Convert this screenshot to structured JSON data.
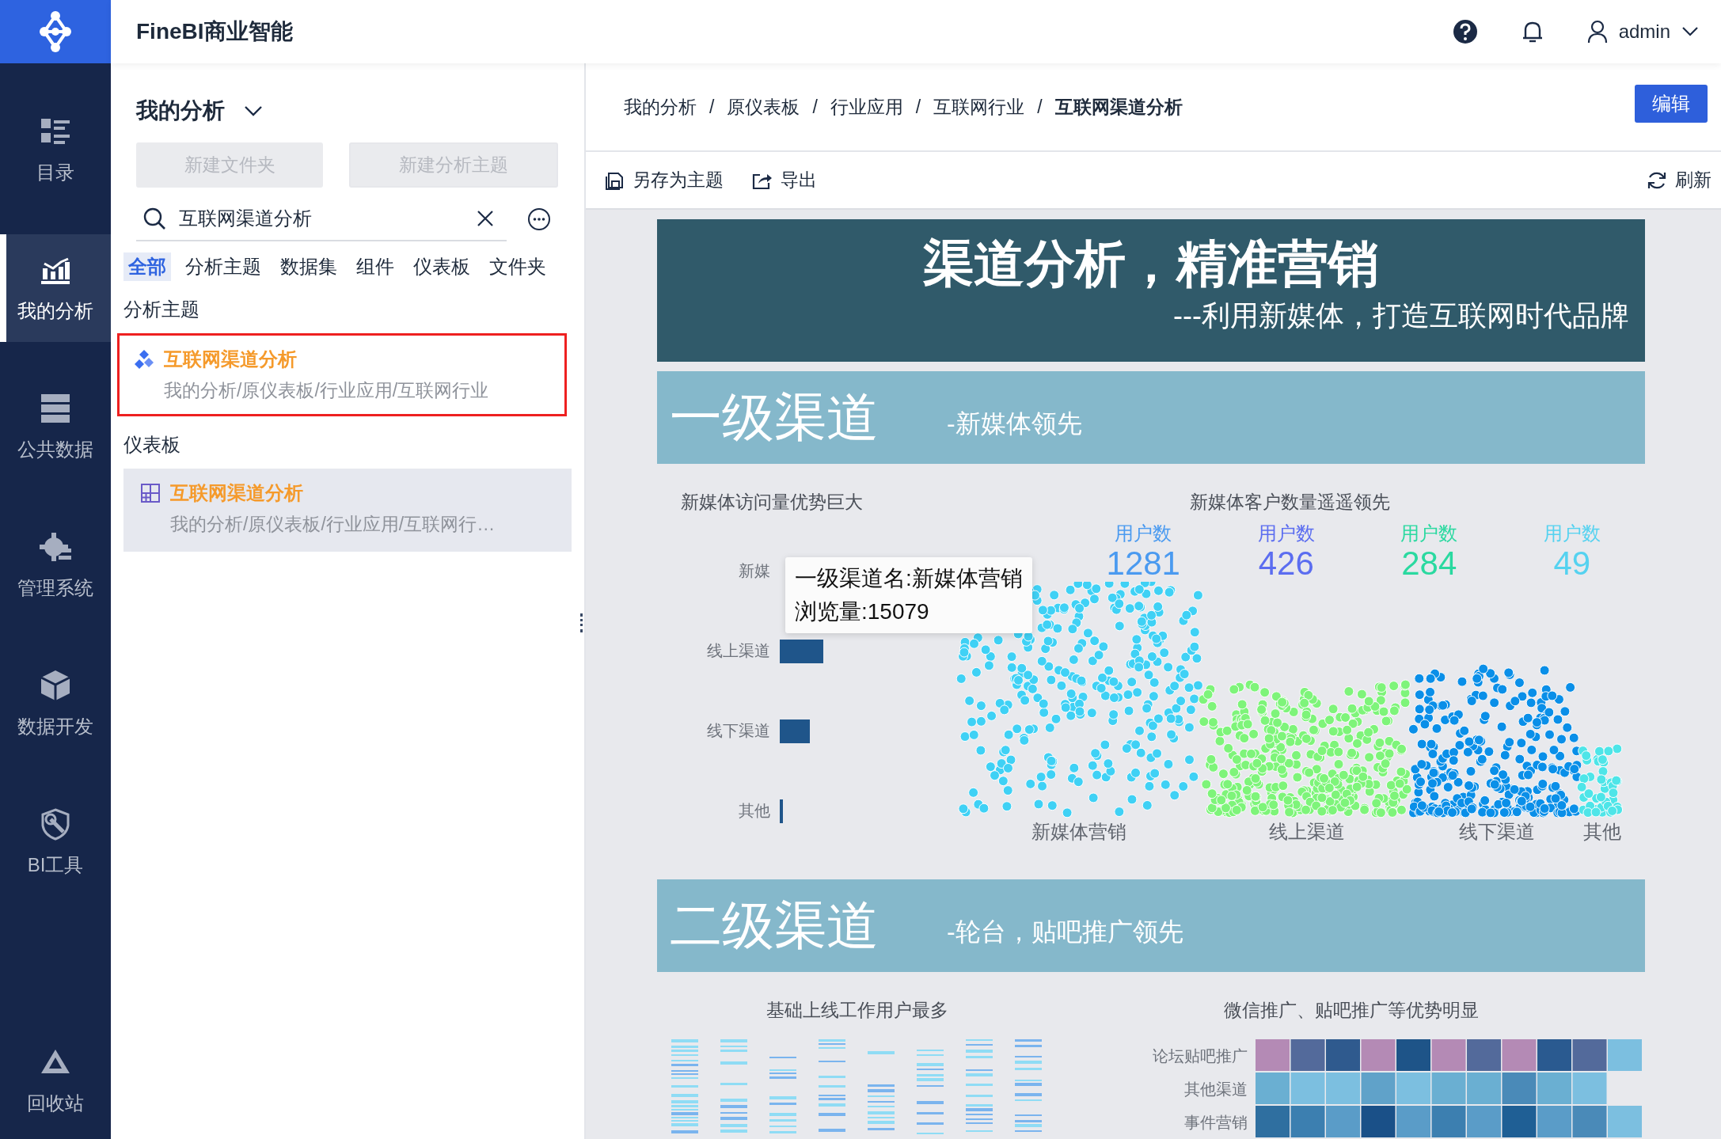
{
  "app": {
    "title": "FineBI商业智能"
  },
  "nav": [
    {
      "kind": "catalog",
      "label": "目录",
      "selected": false
    },
    {
      "kind": "analysis",
      "label": "我的分析",
      "selected": true
    },
    {
      "kind": "public",
      "label": "公共数据",
      "selected": false
    },
    {
      "kind": "manage",
      "label": "管理系统",
      "selected": false
    },
    {
      "kind": "develop",
      "label": "数据开发",
      "selected": false
    },
    {
      "kind": "tools",
      "label": "BI工具",
      "selected": false
    },
    {
      "kind": "recycle",
      "label": "回收站",
      "selected": false
    }
  ],
  "header": {
    "user": "admin"
  },
  "panel": {
    "title": "我的分析",
    "buttons": [
      "新建文件夹",
      "新建分析主题"
    ],
    "search": {
      "value": "互联网渠道分析"
    },
    "filters": [
      {
        "label": "全部",
        "selected": true
      },
      {
        "label": "分析主题",
        "selected": false
      },
      {
        "label": "数据集",
        "selected": false
      },
      {
        "label": "组件",
        "selected": false
      },
      {
        "label": "仪表板",
        "selected": false
      },
      {
        "label": "文件夹",
        "selected": false
      }
    ],
    "groups": [
      {
        "heading": "分析主题",
        "items": [
          {
            "kind": "subject",
            "title": "互联网渠道分析",
            "path": "我的分析/原仪表板/行业应用/互联网行业",
            "selected": false,
            "outlined": true
          }
        ]
      },
      {
        "heading": "仪表板",
        "items": [
          {
            "kind": "dashboard",
            "title": "互联网渠道分析",
            "path": "我的分析/原仪表板/行业应用/互联网行…",
            "selected": true,
            "outlined": false
          }
        ]
      }
    ]
  },
  "breadcrumb": [
    {
      "label": "我的分析",
      "current": false
    },
    {
      "separator": "/",
      "label": "原仪表板",
      "current": false
    },
    {
      "separator": "/",
      "label": "行业应用",
      "current": false
    },
    {
      "separator": "/",
      "label": "互联网行业",
      "current": false
    },
    {
      "separator": "/",
      "label": "互联网渠道分析",
      "current": true
    }
  ],
  "edit_button": "编辑",
  "toolbar": [
    {
      "kind": "save",
      "label": "另存为主题"
    },
    {
      "kind": "export",
      "label": "导出"
    },
    {
      "kind": "refresh",
      "label": "刷新"
    }
  ],
  "dashboard": {
    "banner": {
      "title": "渠道分析，精准营销",
      "subtitle": "---利用新媒体，打造互联网时代品牌"
    },
    "section_1": {
      "title": "一级渠道",
      "subtitle": "-新媒体领先"
    },
    "visits_chart": {
      "title": "新媒体访问量优势巨大",
      "categories": [
        "新媒",
        "线上渠道",
        "线下渠道",
        "其他"
      ],
      "tooltip": [
        "一级渠道名:新媒体营销",
        "浏览量:15079"
      ]
    },
    "customers_chart": {
      "title": "新媒体客户数量遥遥领先",
      "stats": [
        {
          "label": "用户数",
          "value": "1281",
          "color": "#4a9af0"
        },
        {
          "label": "用户数",
          "value": "426",
          "color": "#5b6df0"
        },
        {
          "label": "用户数",
          "value": "284",
          "color": "#2ad9a0"
        },
        {
          "label": "用户数",
          "value": "49",
          "color": "#55d2f0"
        }
      ],
      "categories": [
        "新媒体营销",
        "线上渠道",
        "线下渠道",
        "其他"
      ]
    },
    "section_2": {
      "title": "二级渠道",
      "subtitle": "-轮台，贴吧推广领先"
    },
    "usage_chart": {
      "title": "基础上线工作用户最多"
    },
    "promotion_chart": {
      "title": "微信推广、贴吧推广等优势明显",
      "rows": [
        "论坛贴吧推广",
        "其他渠道",
        "事件营销"
      ]
    }
  }
}
